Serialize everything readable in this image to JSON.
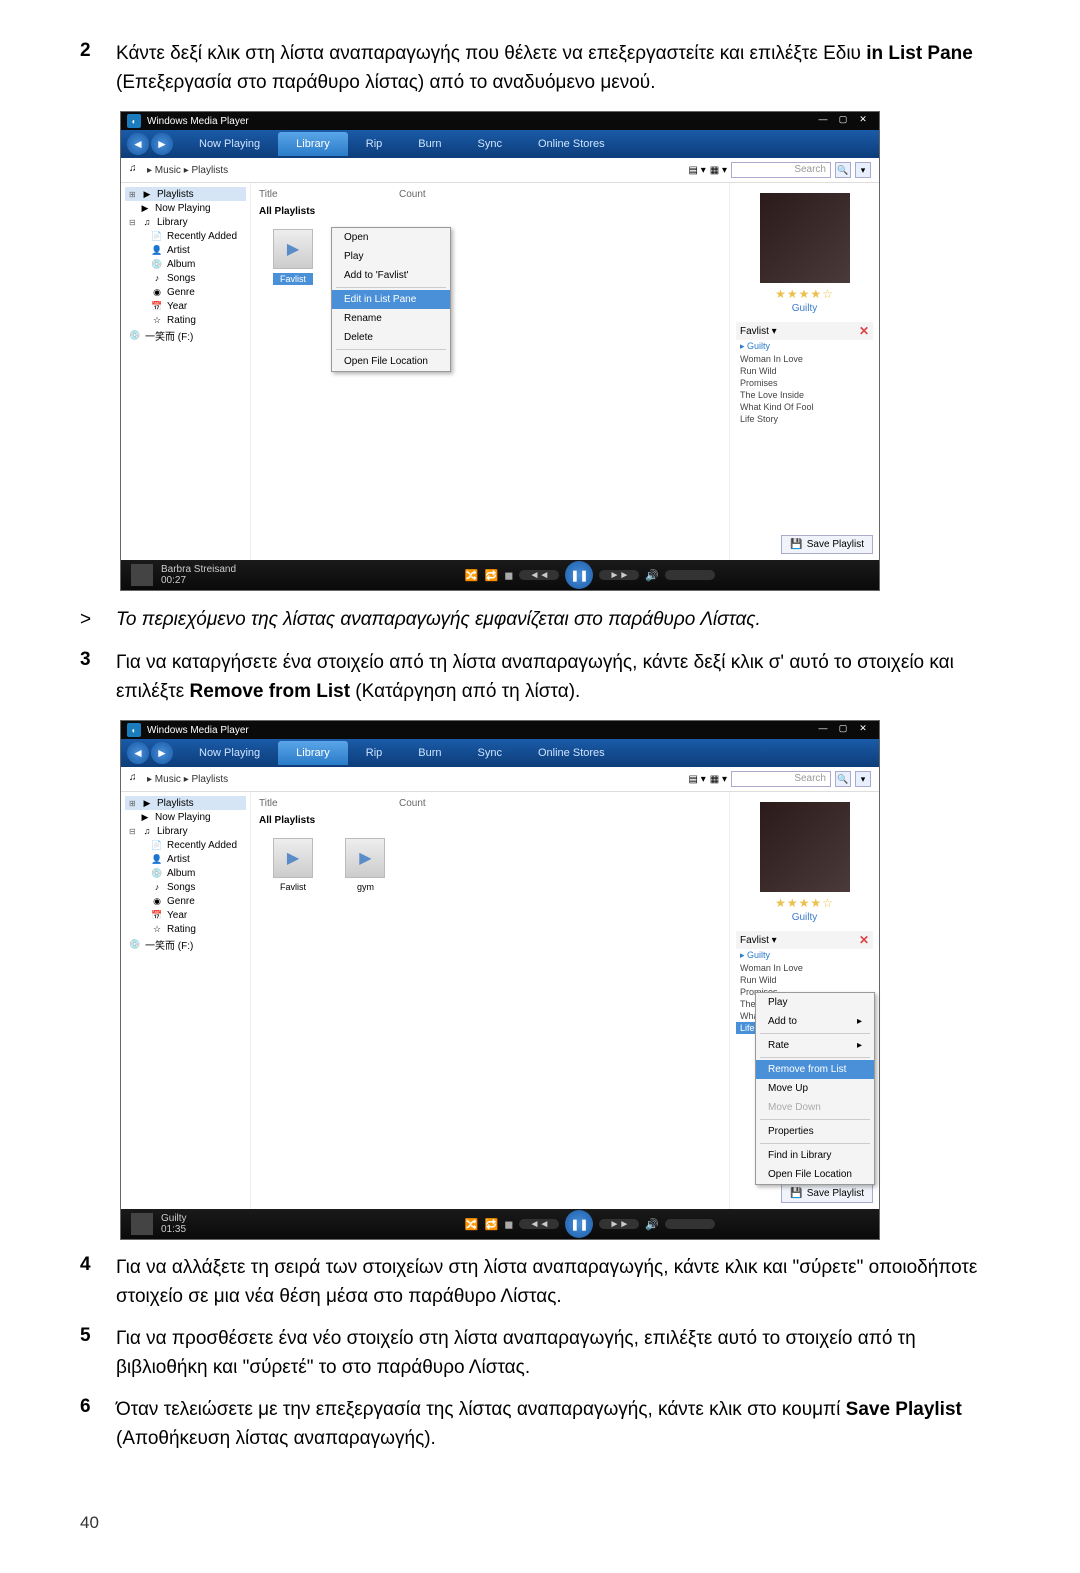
{
  "steps": {
    "2": {
      "num": "2",
      "text_a": "Κάντε δεξί κλικ στη λίστα αναπαραγωγής που θέλετε να επεξεργαστείτε και επιλέξτε Εδιυ ",
      "bold": "in List Pane",
      "text_b": " (Επεξεργασία στο παράθυρο λίστας) από το αναδυόμενο μενού."
    },
    "note": {
      "marker": ">",
      "text": "Το περιεχόμενο της λίστας αναπαραγωγής εμφανίζεται στο παράθυρο Λίστας."
    },
    "3": {
      "num": "3",
      "text_a": "Για να καταργήσετε ένα στοιχείο από τη λίστα αναπαραγωγής, κάντε δεξί κλικ σ' αυτό το στοιχείο και επιλέξτε ",
      "bold": "Remove from List",
      "text_b": " (Κατάργηση από τη λίστα)."
    },
    "4": {
      "num": "4",
      "text": "Για να αλλάξετε τη σειρά των στοιχείων στη λίστα αναπαραγωγής, κάντε κλικ και \"σύρετε\" οποιοδήποτε στοιχείο σε μια νέα θέση μέσα στο παράθυρο Λίστας."
    },
    "5": {
      "num": "5",
      "text": "Για να προσθέσετε ένα νέο στοιχείο στη λίστα αναπαραγωγής, επιλέξτε αυτό το στοιχείο από τη βιβλιοθήκη και \"σύρετέ\" το στο παράθυρο Λίστας."
    },
    "6": {
      "num": "6",
      "text_a": "Όταν τελειώσετε με την επεξεργασία της λίστας αναπαραγωγής, κάντε κλικ στο κουμπί ",
      "bold": "Save Playlist",
      "text_b": " (Αποθήκευση λίστας αναπαραγωγής)."
    }
  },
  "pageNum": "40",
  "wmp": {
    "title": "Windows Media Player",
    "tabs": [
      "Now Playing",
      "Library",
      "Rip",
      "Burn",
      "Sync",
      "Online Stores"
    ],
    "breadcrumb": "▸ Music ▸ Playlists",
    "search": "Search",
    "cols": {
      "title": "Title",
      "count": "Count"
    },
    "allPlaylists": "All Playlists",
    "tree": {
      "playlists": "Playlists",
      "nowPlaying": "Now Playing",
      "library": "Library",
      "recentlyAdded": "Recently Added",
      "artist": "Artist",
      "album": "Album",
      "songs": "Songs",
      "genre": "Genre",
      "year": "Year",
      "rating": "Rating",
      "drive": "一笑而 (F:)"
    },
    "context1": {
      "open": "Open",
      "play": "Play",
      "addTo": "Add to 'Favlist'",
      "edit": "Edit in List Pane",
      "rename": "Rename",
      "delete": "Delete",
      "openLoc": "Open File Location"
    },
    "context2": {
      "play": "Play",
      "addTo": "Add to",
      "rate": "Rate",
      "remove": "Remove from List",
      "moveUp": "Move Up",
      "moveDown": "Move Down",
      "properties": "Properties",
      "findLib": "Find in Library",
      "openLoc": "Open File Location"
    },
    "rightPane": {
      "stars": "★★★★☆",
      "albumName": "Guilty",
      "listName": "Favlist",
      "tracks": [
        "Guilty",
        "Woman In Love",
        "Run Wild",
        "Promises",
        "The Love Inside",
        "What Kind Of Fool",
        "Life Story"
      ],
      "save": "Save Playlist"
    },
    "playlists": {
      "favlist": "Favlist",
      "gym": "gym"
    },
    "player1": {
      "title": "Barbra Streisand",
      "time": "00:27"
    },
    "player2": {
      "title": "Guilty",
      "time": "01:35"
    }
  }
}
